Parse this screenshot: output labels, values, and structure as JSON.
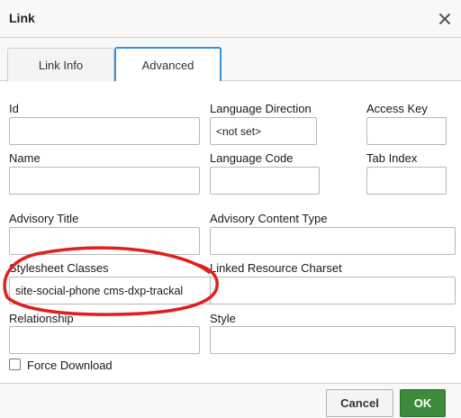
{
  "dialog": {
    "title": "Link",
    "close_icon": "close-icon"
  },
  "tabs": [
    {
      "label": "Link Info",
      "active": false
    },
    {
      "label": "Advanced",
      "active": true
    }
  ],
  "fields": {
    "id": {
      "label": "Id",
      "value": ""
    },
    "language_direction": {
      "label": "Language Direction",
      "value": "<not set>"
    },
    "access_key": {
      "label": "Access Key",
      "value": ""
    },
    "name": {
      "label": "Name",
      "value": ""
    },
    "language_code": {
      "label": "Language Code",
      "value": ""
    },
    "tab_index": {
      "label": "Tab Index",
      "value": ""
    },
    "advisory_title": {
      "label": "Advisory Title",
      "value": ""
    },
    "advisory_content_type": {
      "label": "Advisory Content Type",
      "value": ""
    },
    "stylesheet_classes": {
      "label": "Stylesheet Classes",
      "value": "site-social-phone cms-dxp-trackal"
    },
    "linked_resource_charset": {
      "label": "Linked Resource Charset",
      "value": ""
    },
    "relationship": {
      "label": "Relationship",
      "value": ""
    },
    "style": {
      "label": "Style",
      "value": ""
    }
  },
  "force_download": {
    "label": "Force Download",
    "checked": false
  },
  "buttons": {
    "cancel": "Cancel",
    "ok": "OK"
  },
  "colors": {
    "accent": "#3a8fd6",
    "ok_button": "#3d8a3d",
    "annotation": "#e0201c"
  }
}
